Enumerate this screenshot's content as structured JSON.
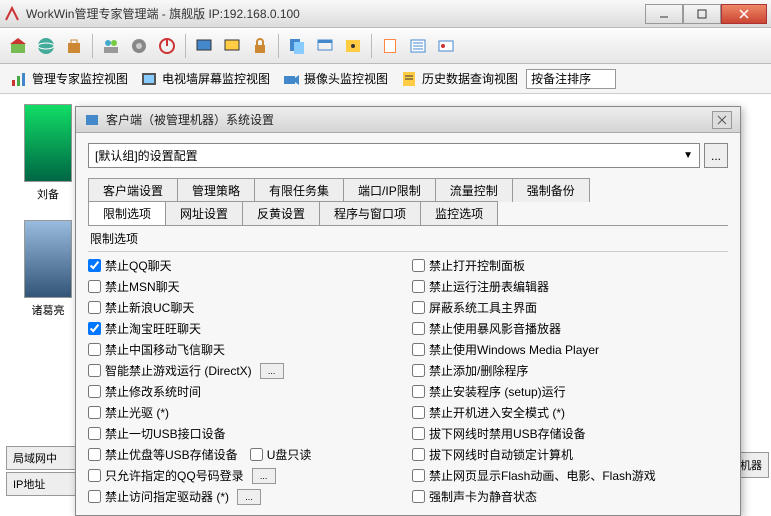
{
  "titlebar": {
    "title": "WorkWin管理专家管理端 - 旗舰版 IP:192.168.0.100"
  },
  "viewbar": {
    "v1": "管理专家监控视图",
    "v2": "电视墙屏幕监控视图",
    "v3": "摄像头监控视图",
    "v4": "历史数据查询视图",
    "sort_value": "按备注排序"
  },
  "thumbs": {
    "t1": "刘备",
    "t2": "诸葛亮"
  },
  "dialog": {
    "title": "客户端（被管理机器）系统设置",
    "combo_text": "[默认组]的设置配置",
    "tabs_row1": [
      "客户端设置",
      "管理策略",
      "有限任务集",
      "端口/IP限制",
      "流量控制",
      "强制备份"
    ],
    "tabs_row2": [
      "限制选项",
      "网址设置",
      "反黄设置",
      "程序与窗口项",
      "监控选项"
    ],
    "group": "限制选项",
    "left": [
      {
        "label": "禁止QQ聊天",
        "checked": true
      },
      {
        "label": "禁止MSN聊天",
        "checked": false
      },
      {
        "label": "禁止新浪UC聊天",
        "checked": false
      },
      {
        "label": "禁止淘宝旺旺聊天",
        "checked": true
      },
      {
        "label": "禁止中国移动飞信聊天",
        "checked": false
      },
      {
        "label": "智能禁止游戏运行 (DirectX)",
        "checked": false,
        "btn": true
      },
      {
        "label": "禁止修改系统时间",
        "checked": false
      },
      {
        "label": "禁止光驱 (*)",
        "checked": false
      },
      {
        "label": "禁止一切USB接口设备",
        "checked": false
      },
      {
        "label": "禁止优盘等USB存储设备",
        "checked": false,
        "extra_cb": "U盘只读"
      },
      {
        "label": "只允许指定的QQ号码登录",
        "checked": false,
        "btn": true
      },
      {
        "label": "禁止访问指定驱动器 (*)",
        "checked": false,
        "btn": true
      }
    ],
    "right": [
      {
        "label": "禁止打开控制面板",
        "checked": false
      },
      {
        "label": "禁止运行注册表编辑器",
        "checked": false
      },
      {
        "label": "屏蔽系统工具主界面",
        "checked": false
      },
      {
        "label": "禁止使用暴风影音播放器",
        "checked": false
      },
      {
        "label": "禁止使用Windows Media Player",
        "checked": false
      },
      {
        "label": "禁止添加/删除程序",
        "checked": false
      },
      {
        "label": "禁止安装程序 (setup)运行",
        "checked": false
      },
      {
        "label": "禁止开机进入安全模式 (*)",
        "checked": false
      },
      {
        "label": "拔下网线时禁用USB存储设备",
        "checked": false
      },
      {
        "label": "拔下网线时自动锁定计算机",
        "checked": false
      },
      {
        "label": "禁止网页显示Flash动画、电影、Flash游戏",
        "checked": false
      },
      {
        "label": "强制声卡为静音状态",
        "checked": false
      }
    ]
  },
  "bottom": {
    "t1": "局域网中",
    "t2": "IP地址",
    "side": "监视机器"
  }
}
